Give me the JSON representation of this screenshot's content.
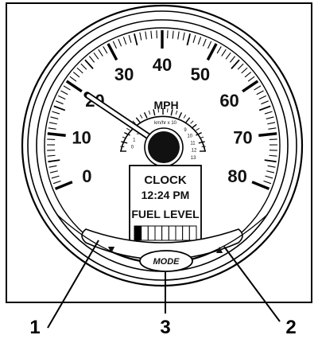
{
  "gauge": {
    "unit": "MPH",
    "speed_labels": [
      "0",
      "10",
      "20",
      "30",
      "40",
      "50",
      "60",
      "70",
      "80"
    ],
    "speed_min": 0,
    "speed_max": 80,
    "needle_value": 20,
    "inner_scale_caption": "km/hr x 10",
    "inner_scale_labels": [
      "0",
      "1",
      "2",
      "9",
      "10",
      "11",
      "12",
      "13"
    ]
  },
  "display": {
    "line1": "CLOCK",
    "line2": "12:24 PM",
    "line3": "FUEL LEVEL",
    "fuel_segments_total": 9,
    "fuel_segments_filled": 1
  },
  "buttons": {
    "left_arrow": "▼",
    "mode_label": "MODE",
    "right_arrow": "▲"
  },
  "callouts": [
    "1",
    "3",
    "2"
  ]
}
